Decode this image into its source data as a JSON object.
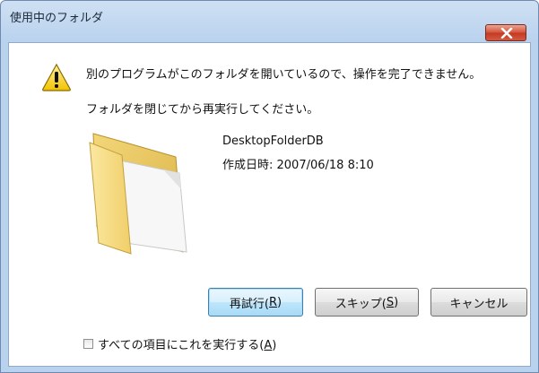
{
  "window": {
    "title": "使用中のフォルダ"
  },
  "message": {
    "line1": "別のプログラムがこのフォルダを開いているので、操作を完了できません。",
    "line2": "フォルダを閉じてから再実行してください。"
  },
  "item": {
    "name": "DesktopFolderDB",
    "created_label": "作成日時: 2007/06/18 8:10"
  },
  "buttons": {
    "retry": {
      "text": "再試行(",
      "key": "R",
      "close": ")"
    },
    "skip": {
      "text": "スキップ(",
      "key": "S",
      "close": ")"
    },
    "cancel": {
      "text": "キャンセル"
    }
  },
  "checkbox": {
    "text": "すべての項目にこれを実行する(",
    "key": "A",
    "close": ")",
    "checked": false
  },
  "icons": {
    "warning": "warning-icon",
    "folder": "folder-icon",
    "close": "close-icon"
  }
}
